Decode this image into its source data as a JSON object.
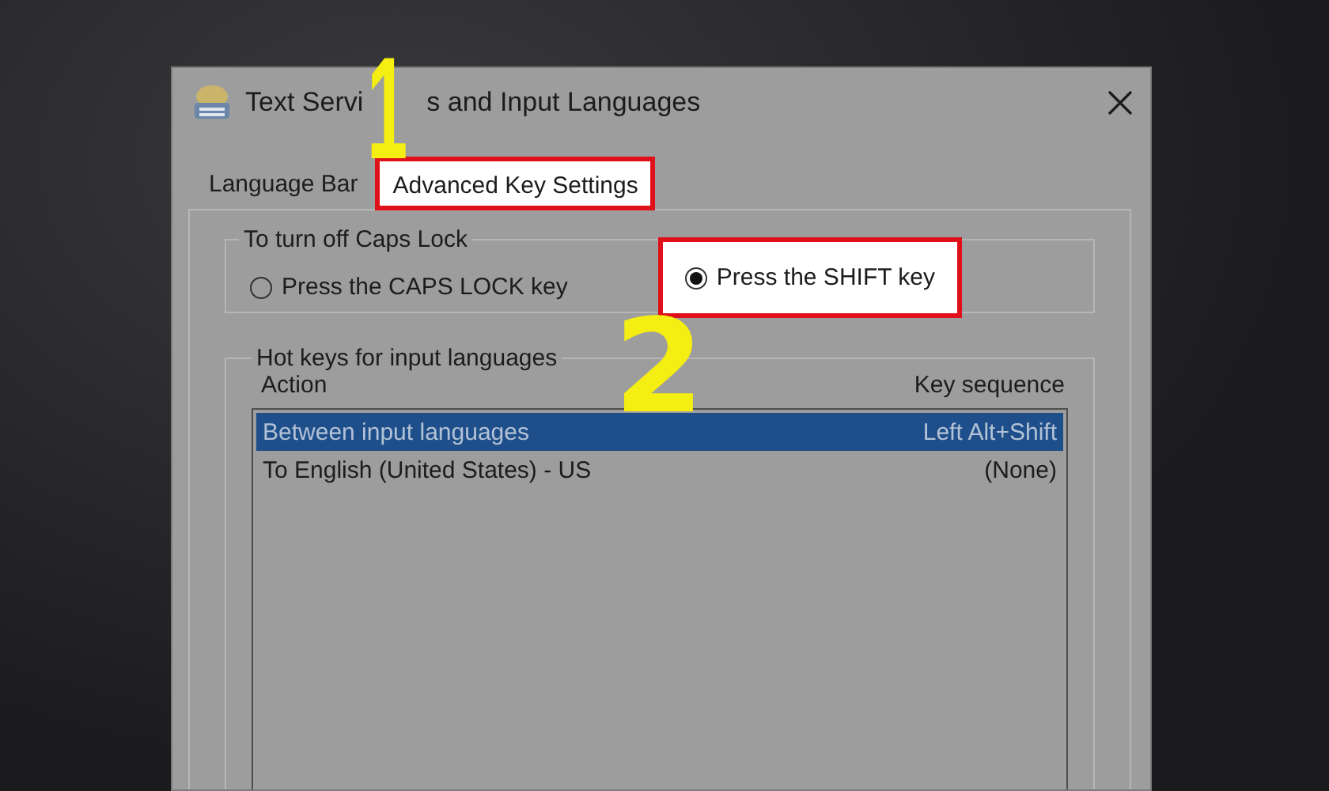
{
  "window": {
    "title_parts": [
      "Text Servi",
      "s and Input Languages"
    ]
  },
  "tabs": [
    {
      "label": "Language Bar",
      "selected": false,
      "highlighted": false
    },
    {
      "label": "Advanced Key Settings",
      "selected": true,
      "highlighted": true
    }
  ],
  "caps_lock": {
    "title": "To turn off Caps Lock",
    "options": [
      {
        "label": "Press the CAPS LOCK key",
        "selected": false,
        "highlighted": false
      },
      {
        "label": "Press the SHIFT key",
        "selected": true,
        "highlighted": true
      }
    ]
  },
  "hot_keys": {
    "title": "Hot keys for input languages",
    "columns": [
      "Action",
      "Key sequence"
    ],
    "rows": [
      {
        "cells": [
          "Between input languages",
          "Left Alt+Shift"
        ],
        "selected": true
      },
      {
        "cells": [
          "To English (United States) - US",
          "(None)"
        ],
        "selected": false
      }
    ]
  },
  "annotations": [
    {
      "label": "1"
    },
    {
      "label": "2"
    }
  ]
}
